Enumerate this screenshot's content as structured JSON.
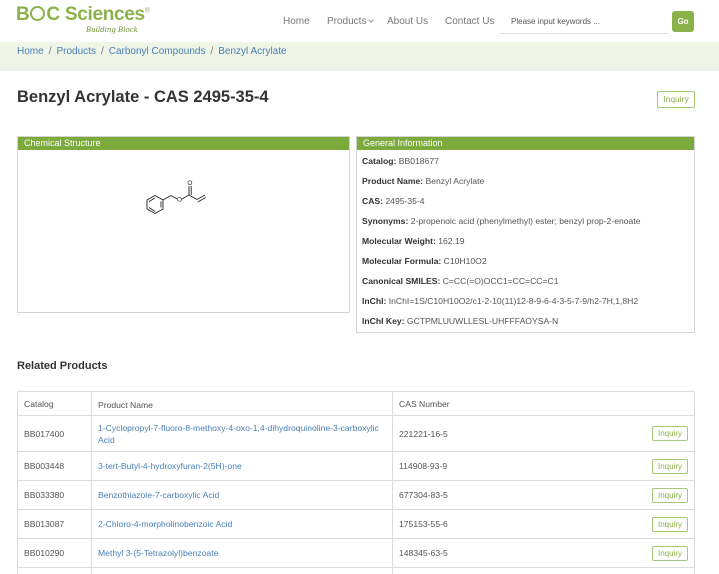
{
  "header": {
    "logo_text_b": "B",
    "logo_text_rest": "C Sciences",
    "logo_reg": "®",
    "logo_tagline": "Building Block",
    "nav": {
      "home": "Home",
      "products": "Products",
      "about": "About Us",
      "contact": "Contact Us"
    },
    "search_placeholder": "Please input keywords ...",
    "go_label": "Go",
    "brand_color": "#8bb24a"
  },
  "breadcrumb": {
    "home": "Home",
    "products": "Products",
    "category": "Carbonyl Compounds",
    "current": "Benzyl Acrylate",
    "separator": "/"
  },
  "page_title": "Benzyl Acrylate - CAS 2495-35-4",
  "inquiry_label": "Inquiry",
  "structure_panel": {
    "heading": "Chemical Structure"
  },
  "info_panel": {
    "heading": "General Information",
    "rows": [
      {
        "label": "Catalog:",
        "value": "BB018677"
      },
      {
        "label": "Product Name:",
        "value": "Benzyl Acrylate"
      },
      {
        "label": "CAS:",
        "value": "2495-35-4"
      },
      {
        "label": "Synonyms:",
        "value": "2-propenoic acid (phenylmethyl) ester; benzyl prop-2-enoate"
      },
      {
        "label": "Molecular Weight:",
        "value": "162.19"
      },
      {
        "label": "Molecular Formula:",
        "value": "C10H10O2"
      },
      {
        "label": "Canonical SMILES:",
        "value": "C=CC(=O)OCC1=CC=CC=C1"
      },
      {
        "label": "InChI:",
        "value": "InChI=1S/C10H10O2/c1-2-10(11)12-8-9-6-4-3-5-7-9/h2-7H,1,8H2"
      },
      {
        "label": "InChI Key:",
        "value": "GCTPMLUUWLLESL-UHFFFAOYSA-N"
      }
    ]
  },
  "related": {
    "title": "Related Products",
    "headers": {
      "catalog": "Catalog",
      "name": "Product Name",
      "cas": "CAS Number"
    },
    "rows": [
      {
        "catalog": "BB017400",
        "name": "1-Cyclopropyl-7-fluoro-8-methoxy-4-oxo-1,4-dihydroquinoline-3-carboxylic Acid",
        "cas": "221221-16-5"
      },
      {
        "catalog": "BB003448",
        "name": "3-tert-Butyl-4-hydroxyfuran-2(5H)-one",
        "cas": "114908-93-9"
      },
      {
        "catalog": "BB033380",
        "name": "Benzothiazole-7-carboxylic Acid",
        "cas": "677304-83-5"
      },
      {
        "catalog": "BB013087",
        "name": "2-Chloro-4-morpholinobenzoic Acid",
        "cas": "175153-55-6"
      },
      {
        "catalog": "BB010290",
        "name": "Methyl 3-(5-Tetrazolyl)benzoate",
        "cas": "148345-63-5"
      }
    ]
  }
}
